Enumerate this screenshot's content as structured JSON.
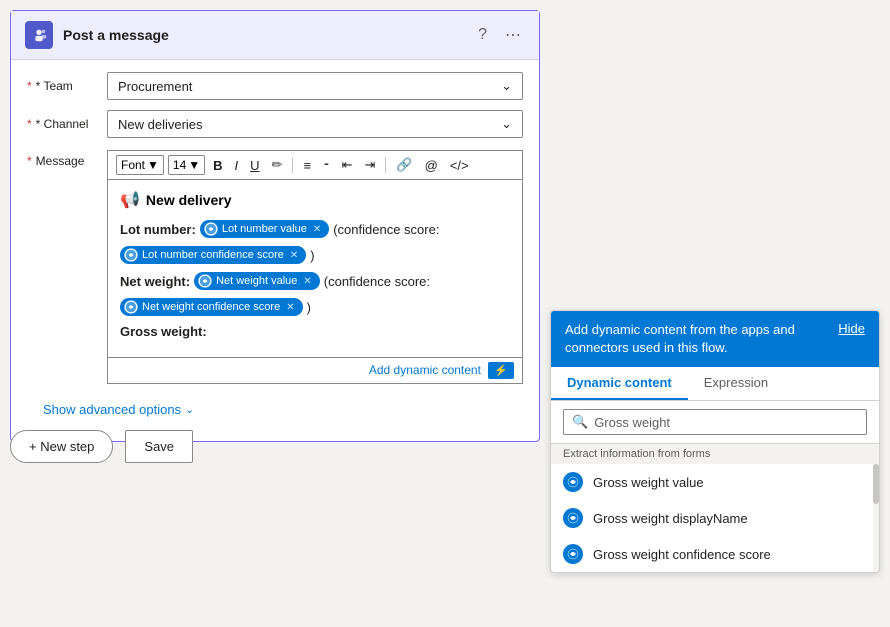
{
  "card": {
    "title": "Post a message",
    "team_label": "* Team",
    "team_value": "Procurement",
    "channel_label": "* Channel",
    "channel_value": "New deliveries",
    "message_label": "* Message"
  },
  "toolbar": {
    "font_label": "Font",
    "font_size": "14",
    "bold": "B",
    "italic": "I",
    "underline": "U"
  },
  "message": {
    "heading": "New delivery",
    "lot_label": "Lot number:",
    "lot_tag": "Lot number value",
    "confidence_text": "(confidence score:",
    "lot_confidence_tag": "Lot number confidence score",
    "close_paren": ")",
    "net_label": "Net weight:",
    "net_tag": "Net weight value",
    "net_confidence_tag": "Net weight confidence score",
    "gross_label": "Gross weight:"
  },
  "add_dynamic": "Add dynamic content",
  "advanced_options": "Show advanced options",
  "buttons": {
    "new_step": "+ New step",
    "save": "Save"
  },
  "dynamic_panel": {
    "header_text": "Add dynamic content from the apps and connectors used in this flow.",
    "hide_label": "Hide",
    "tab_dynamic": "Dynamic content",
    "tab_expression": "Expression",
    "search_placeholder": "Gross weight",
    "section_label": "Extract information from forms",
    "items": [
      {
        "label": "Gross weight value"
      },
      {
        "label": "Gross weight displayName"
      },
      {
        "label": "Gross weight confidence score"
      }
    ]
  }
}
